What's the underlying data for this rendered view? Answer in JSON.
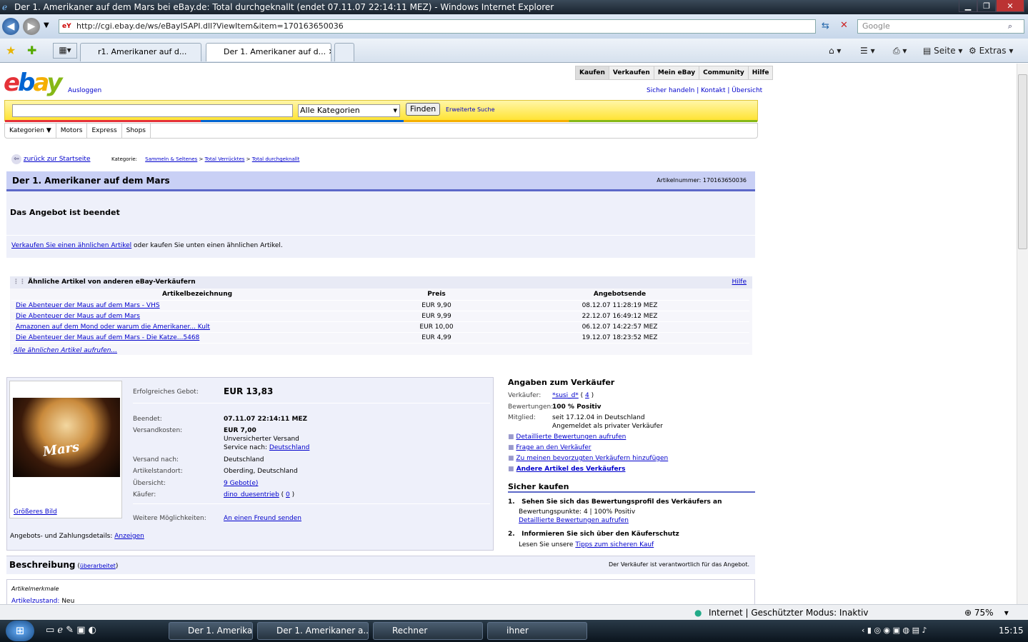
{
  "window": {
    "title": "Der 1. Amerikaner auf dem Mars bei eBay.de: Total durchgeknallt (endet 07.11.07 22:14:11 MEZ) - Windows Internet Explorer",
    "min": "▁",
    "max": "❐",
    "close": "✕"
  },
  "browser": {
    "url": "http://cgi.ebay.de/ws/eBayISAPI.dll?ViewItem&item=170163650036",
    "search_placeholder": "Google",
    "tabs": [
      "r1. Amerikaner auf d...",
      "Der 1. Amerikaner auf d..."
    ],
    "tools": {
      "page": "Seite",
      "extras": "Extras"
    }
  },
  "ebay": {
    "logout": "Ausloggen",
    "topnav": [
      "Kaufen",
      "Verkaufen",
      "Mein eBay",
      "Community",
      "Hilfe"
    ],
    "toplinks": "Sicher handeln | Kontakt | Übersicht",
    "category_select": "Alle Kategorien",
    "find_button": "Finden",
    "advanced_search": "Erweiterte Suche",
    "catnav": [
      "Kategorien ▼",
      "Motors",
      "Express",
      "Shops"
    ],
    "back": "zurück zur Startseite",
    "category_label": "Kategorie:",
    "breadcrumb": [
      "Sammeln & Seltenes",
      ">",
      "Total Verrücktes",
      ">",
      "Total durchgeknallt"
    ],
    "title": "Der 1. Amerikaner auf dem Mars",
    "item_number": "Artikelnummer: 170163650036",
    "ended": "Das Angebot ist beendet",
    "sell_similar_link": "Verkaufen Sie einen ähnlichen Artikel",
    "sell_similar_rest": " oder kaufen Sie unten einen ähnlichen Artikel.",
    "similar": {
      "heading": "Ähnliche Artikel von anderen eBay-Verkäufern",
      "help": "Hilfe",
      "columns": [
        "Artikelbezeichnung",
        "Preis",
        "Angebotsende"
      ],
      "rows": [
        [
          "Die Abenteuer der Maus auf dem Mars - VHS",
          "EUR 9,90",
          "08.12.07 11:28:19 MEZ"
        ],
        [
          "Die Abenteuer der Maus auf dem Mars",
          "EUR 9,99",
          "22.12.07 16:49:12 MEZ"
        ],
        [
          "Amazonen auf dem Mond oder warum die Amerikaner... Kult",
          "EUR 10,00",
          "06.12.07 14:22:57 MEZ"
        ],
        [
          "Die Abenteuer der Maus auf dem Mars - Die Katze...5468",
          "EUR 4,99",
          "19.12.07 18:23:52 MEZ"
        ]
      ],
      "all_link": "Alle ähnlichen Artikel aufrufen..."
    },
    "item": {
      "image_text": "Mars",
      "bigger_image": "Größeres Bild",
      "winning_bid_label": "Erfolgreiches Gebot:",
      "winning_bid": "EUR 13,83",
      "ended_label": "Beendet:",
      "ended_value": "07.11.07 22:14:11 MEZ",
      "shipping_label": "Versandkosten:",
      "shipping_value": "EUR 7,00",
      "shipping_note": "Unversicherter Versand",
      "service_label": "Service nach: ",
      "service_link": "Deutschland",
      "ship_to_label": "Versand nach:",
      "ship_to": "Deutschland",
      "location_label": "Artikelstandort:",
      "location": "Oberding, Deutschland",
      "overview_label": "Übersicht:",
      "overview": "9 Gebot(e)",
      "buyer_label": "Käufer:",
      "buyer": "dino_duesentrieb",
      "buyer_score": "0",
      "more_label": "Weitere Möglichkeiten:",
      "more_link": "An einen Freund senden",
      "details_label": "Angebots- und Zahlungsdetails:",
      "details_link": "Anzeigen"
    },
    "seller": {
      "heading": "Angaben zum Verkäufer",
      "seller_label": "Verkäufer:",
      "seller": "*susi_d*",
      "seller_score": "4",
      "rating_label": "Bewertungen:",
      "rating": "100 % Positiv",
      "member_label": "Mitglied:",
      "member": "seit 17.12.04 in Deutschland",
      "member2": "Angemeldet als privater Verkäufer",
      "links": [
        "Detaillierte Bewertungen aufrufen",
        "Frage an den Verkäufer",
        "Zu meinen bevorzugten Verkäufern hinzufügen",
        "Andere Artikel des Verkäufers"
      ]
    },
    "safe": {
      "heading": "Sicher kaufen",
      "s1": "Sehen Sie sich das Bewertungsprofil des Verkäufers an",
      "s1a": "Bewertungspunkte: 4 | 100% Positiv",
      "s1b": "Detaillierte Bewertungen aufrufen",
      "s2": "Informieren Sie sich über den Käuferschutz",
      "s2a": "Lesen Sie unsere ",
      "s2b": "Tipps zum sicheren Kauf"
    },
    "description": {
      "heading": "Beschreibung",
      "edited": "überarbeitet",
      "note": "Der Verkäufer ist verantwortlich für das Angebot.",
      "features": "Artikelmerkmale",
      "condition_label": "Artikelzustand:",
      "condition": "Neu"
    }
  },
  "status": {
    "zone": "Internet | Geschützter Modus: Inaktiv",
    "zoom": "75%"
  },
  "taskbar": {
    "items": [
      "Der 1. Amerika",
      "Der 1. Amerikaner a...",
      "Rechner",
      "ihner"
    ],
    "clock": "15:15"
  }
}
